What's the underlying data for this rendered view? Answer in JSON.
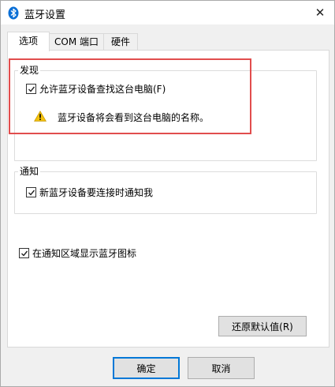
{
  "window": {
    "title": "蓝牙设置",
    "close_symbol": "✕"
  },
  "tabs": [
    {
      "label": "选项",
      "active": true
    },
    {
      "label": "COM 端口",
      "active": false
    },
    {
      "label": "硬件",
      "active": false
    }
  ],
  "discovery": {
    "group_label": "发现",
    "allow_discover_label": "允许蓝牙设备查找这台电脑(F)",
    "allow_discover_checked": true,
    "warning_text": "蓝牙设备将会看到这台电脑的名称。"
  },
  "notification": {
    "group_label": "通知",
    "notify_label": "新蓝牙设备要连接时通知我",
    "notify_checked": true
  },
  "tray": {
    "show_icon_label": "在通知区域显示蓝牙图标",
    "show_icon_checked": true
  },
  "buttons": {
    "restore_defaults": "还原默认值(R)",
    "ok": "确定",
    "cancel": "取消"
  },
  "colors": {
    "highlight": "#e14d4d",
    "accent": "#0078d7",
    "warning": "#f4c20d"
  }
}
